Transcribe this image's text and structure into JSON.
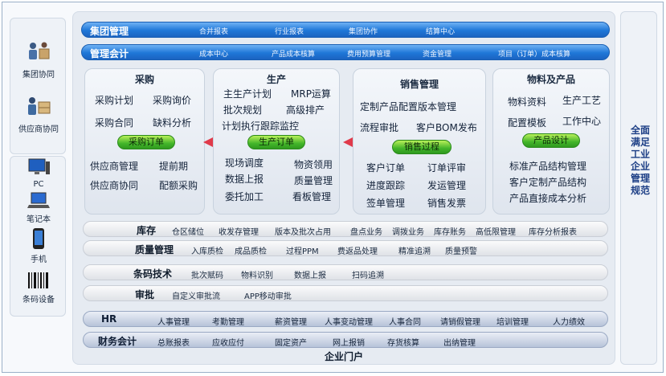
{
  "left": {
    "top_items": [
      {
        "label": "集团协同",
        "icon": "group-collab-icon"
      },
      {
        "label": "供应商协同",
        "icon": "supplier-collab-icon"
      }
    ],
    "device_items": [
      {
        "label": "PC",
        "icon": "pc-icon"
      },
      {
        "label": "笔记本",
        "icon": "laptop-icon"
      },
      {
        "label": "手机",
        "icon": "phone-icon"
      },
      {
        "label": "条码设备",
        "icon": "barcode-icon"
      }
    ]
  },
  "bars": {
    "group_mgmt": {
      "title": "集团管理",
      "items": [
        "合并报表",
        "行业报表",
        "集团协作",
        "结算中心"
      ]
    },
    "mgmt_acct": {
      "title": "管理会计",
      "items": [
        "成本中心",
        "产品成本核算",
        "费用预算管理",
        "资金管理",
        "项目（订单）成本核算"
      ]
    }
  },
  "modules": {
    "purchase": {
      "title": "采购",
      "items": [
        "采购计划",
        "采购询价",
        "采购合同",
        "缺料分析"
      ],
      "button": "采购订单",
      "bottom": [
        "供应商管理",
        "提前期",
        "供应商协同",
        "配额采购"
      ]
    },
    "production": {
      "title": "生产",
      "items": [
        "主生产计划",
        "MRP运算",
        "批次规划",
        "高级排产",
        "计划执行跟踪监控"
      ],
      "button": "生产订单",
      "bottom": [
        "现场调度",
        "物资领用",
        "数据上报",
        "质量管理",
        "委托加工",
        "看板管理"
      ]
    },
    "sales": {
      "title": "销售管理",
      "items": [
        "定制产品配置版本管理",
        "流程审批",
        "客户BOM发布"
      ],
      "button": "销售过程",
      "bottom": [
        "客户订单",
        "订单评审",
        "进度跟踪",
        "发运管理",
        "签单管理",
        "销售发票"
      ]
    },
    "material": {
      "title": "物料及产品",
      "items": [
        "物料资料",
        "生产工艺",
        "配置模板",
        "工作中心"
      ],
      "button": "产品设计",
      "bottom": [
        "标准产品结构管理",
        "客户定制产品结构",
        "产品直接成本分析"
      ]
    }
  },
  "gray_bars": [
    {
      "title": "库存",
      "items": [
        "仓区储位",
        "收发存管理",
        "版本及批次占用",
        "盘点业务",
        "调拨业务",
        "库存账务",
        "高低限管理",
        "库存分析报表"
      ]
    },
    {
      "title": "质量管理",
      "items": [
        "入库质检",
        "成品质检",
        "过程PPM",
        "费返品处理",
        "精准追溯",
        "质量预警"
      ]
    },
    {
      "title": "条码技术",
      "items": [
        "批次赋码",
        "物料识别",
        "数据上报",
        "扫码追溯"
      ]
    },
    {
      "title": "审批",
      "items": [
        "自定义审批流",
        "APP移动审批"
      ]
    }
  ],
  "navy_bars": [
    {
      "title": "HR",
      "items": [
        "人事管理",
        "考勤管理",
        "薪资管理",
        "人事变动管理",
        "人事合同",
        "请销假管理",
        "培训管理",
        "人力绩效"
      ]
    },
    {
      "title": "财务会计",
      "items": [
        "总账报表",
        "应收应付",
        "固定资产",
        "网上报销",
        "存货核算",
        "出纳管理"
      ]
    }
  ],
  "portal": "企业门户",
  "right_text": "全面满足工业企业管理规范",
  "colors": {
    "blue_bar": "#1f77d8",
    "green_button": "#43b52a",
    "arrow": "#e03a4a",
    "right_text": "#1d3f86"
  }
}
